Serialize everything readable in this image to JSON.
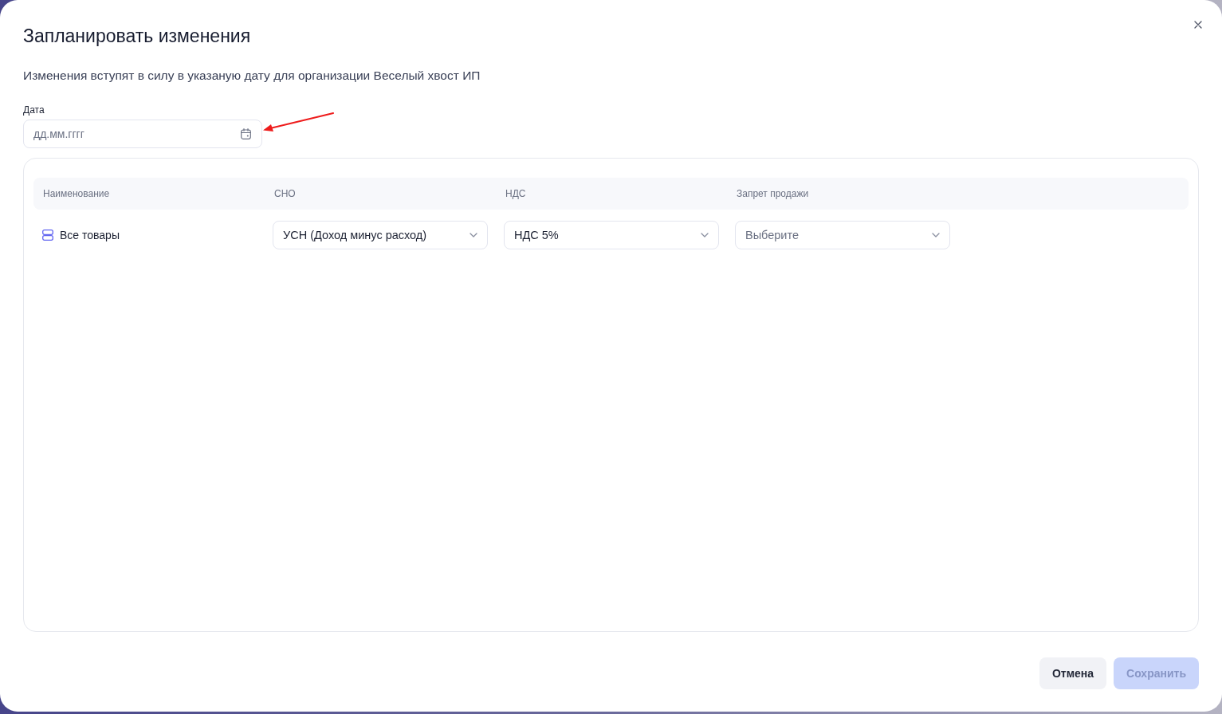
{
  "dialog": {
    "title": "Запланировать изменения",
    "description": "Изменения вступят в силу в указаную дату для организации Веселый хвост ИП",
    "date_field": {
      "label": "Дата",
      "placeholder": "дд.мм.гггг"
    },
    "table": {
      "columns": [
        "Наименование",
        "СНО",
        "НДС",
        "Запрет продажи"
      ],
      "rows": [
        {
          "name": "Все товары",
          "selects": [
            {
              "value": "УСН (Доход минус расход)"
            },
            {
              "value": "НДС 5%"
            },
            {
              "placeholder": "Выберите"
            }
          ]
        }
      ]
    },
    "buttons": [
      {
        "label": "Отмена",
        "kind": "secondary",
        "disabled": false
      },
      {
        "label": "Сохранить",
        "kind": "primary",
        "disabled": true
      }
    ]
  },
  "annotations": [
    {
      "kind": "arrow"
    }
  ]
}
